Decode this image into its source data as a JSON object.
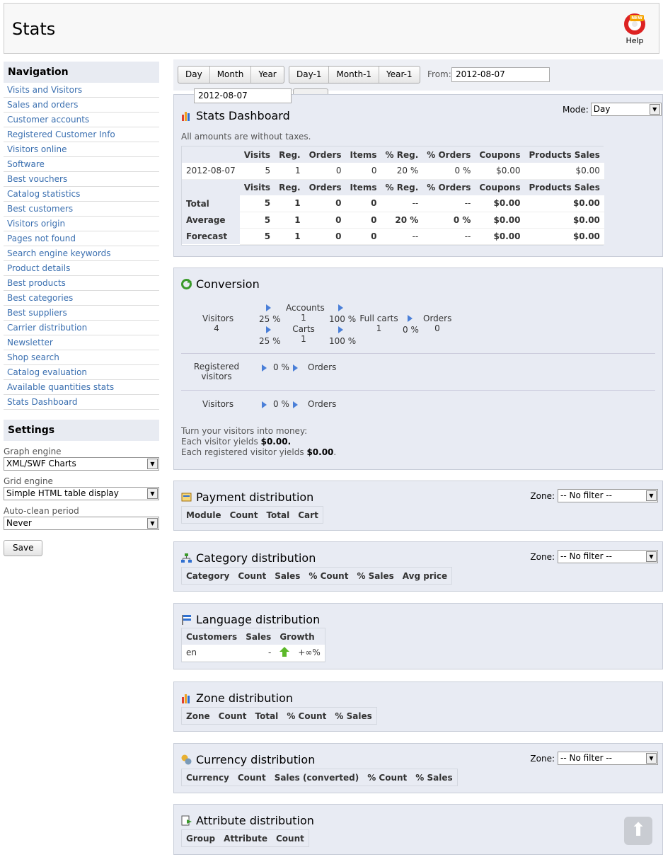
{
  "header": {
    "title": "Stats",
    "help_label": "Help",
    "help_badge": "NEW"
  },
  "navigation": {
    "title": "Navigation",
    "items": [
      "Visits and Visitors",
      "Sales and orders",
      "Customer accounts",
      "Registered Customer Info",
      "Visitors online",
      "Software",
      "Best vouchers",
      "Catalog statistics",
      "Best customers",
      "Visitors origin",
      "Pages not found",
      "Search engine keywords",
      "Product details",
      "Best products",
      "Best categories",
      "Best suppliers",
      "Carrier distribution",
      "Newsletter",
      "Shop search",
      "Catalog evaluation",
      "Available quantities stats",
      "Stats Dashboard"
    ]
  },
  "settings": {
    "title": "Settings",
    "graph_engine_label": "Graph engine",
    "graph_engine_value": "XML/SWF Charts",
    "grid_engine_label": "Grid engine",
    "grid_engine_value": "Simple HTML table display",
    "autoclean_label": "Auto-clean period",
    "autoclean_value": "Never",
    "save_label": "Save"
  },
  "toolbar": {
    "day": "Day",
    "month": "Month",
    "year": "Year",
    "day1": "Day-1",
    "month1": "Month-1",
    "year1": "Year-1",
    "from_label": "From:",
    "from_value": "2012-08-07",
    "to_value": "2012-08-07"
  },
  "dashboard": {
    "title": "Stats Dashboard",
    "mode_label": "Mode:",
    "mode_value": "Day",
    "note": "All amounts are without taxes.",
    "headers": [
      "",
      "Visits",
      "Reg.",
      "Orders",
      "Items",
      "% Reg.",
      "% Orders",
      "Coupons",
      "Products Sales"
    ],
    "row": [
      "2012-08-07",
      "5",
      "1",
      "0",
      "0",
      "20 %",
      "0 %",
      "$0.00",
      "$0.00"
    ],
    "summary": [
      [
        "Total",
        "5",
        "1",
        "0",
        "0",
        "--",
        "--",
        "$0.00",
        "$0.00"
      ],
      [
        "Average",
        "5",
        "1",
        "0",
        "0",
        "20 %",
        "0 %",
        "$0.00",
        "$0.00"
      ],
      [
        "Forecast",
        "5",
        "1",
        "0",
        "0",
        "--",
        "--",
        "$0.00",
        "$0.00"
      ]
    ]
  },
  "conversion": {
    "title": "Conversion",
    "visitors_label": "Visitors",
    "visitors_value": "4",
    "pct_top": "25 %",
    "pct_bottom": "25 %",
    "accounts_label": "Accounts",
    "accounts_value": "1",
    "carts_label": "Carts",
    "carts_value": "1",
    "pct_100_top": "100 %",
    "pct_100_bottom": "100 %",
    "full_carts_label": "Full carts",
    "full_carts_value": "1",
    "pct_0": "0 %",
    "orders_label": "Orders",
    "orders_value": "0",
    "reg_visitors_label": "Registered visitors",
    "reg_pct": "0 %",
    "reg_orders": "Orders",
    "vis_label": "Visitors",
    "vis_pct": "0 %",
    "vis_orders": "Orders",
    "money_line1": "Turn your visitors into money:",
    "money_line2_pre": "Each visitor yields ",
    "money_line2_val": "$0.00.",
    "money_line3_pre": "Each registered visitor yields ",
    "money_line3_val": "$0.00",
    "money_line3_post": "."
  },
  "payment": {
    "title": "Payment distribution",
    "zone_label": "Zone:",
    "zone_value": "-- No filter --",
    "headers": [
      "Module",
      "Count",
      "Total",
      "Cart"
    ]
  },
  "category": {
    "title": "Category distribution",
    "zone_label": "Zone:",
    "zone_value": "-- No filter --",
    "headers": [
      "Category",
      "Count",
      "Sales",
      "% Count",
      "% Sales",
      "Avg price"
    ]
  },
  "language": {
    "title": "Language distribution",
    "headers": [
      "Customers",
      "Sales",
      "%",
      "Growth"
    ],
    "row": [
      "en",
      "",
      "-",
      "",
      "+∞%"
    ]
  },
  "zone_dist": {
    "title": "Zone distribution",
    "headers": [
      "Zone",
      "Count",
      "Total",
      "% Count",
      "% Sales"
    ]
  },
  "currency": {
    "title": "Currency distribution",
    "zone_label": "Zone:",
    "zone_value": "-- No filter --",
    "headers": [
      "Currency",
      "Count",
      "Sales (converted)",
      "% Count",
      "% Sales"
    ]
  },
  "attribute": {
    "title": "Attribute distribution",
    "headers": [
      "Group",
      "Attribute",
      "Count"
    ]
  },
  "colors": {
    "link": "#3a6fb0",
    "panel_bg": "#e8ebf3",
    "accent_arrow": "#4a7fd8"
  }
}
